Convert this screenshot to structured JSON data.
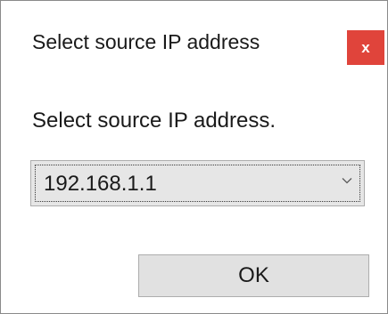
{
  "dialog": {
    "title": "Select source IP address",
    "close_label": "x",
    "close_color": "#e0443b",
    "prompt": "Select source IP address.",
    "ip_select": {
      "selected_value": "192.168.1.1",
      "icon": "chevron-down-icon"
    },
    "ok_label": "OK"
  }
}
